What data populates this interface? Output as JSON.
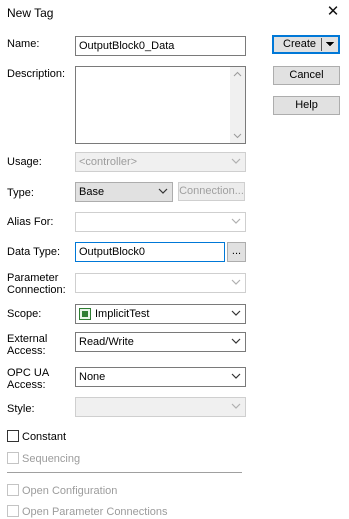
{
  "window": {
    "title": "New Tag",
    "close_glyph": "✕"
  },
  "buttons": {
    "create": "Create",
    "cancel": "Cancel",
    "help": "Help",
    "connection": "Connection...",
    "browse": "..."
  },
  "labels": {
    "name": "Name:",
    "description": "Description:",
    "usage": "Usage:",
    "type": "Type:",
    "alias_for": "Alias For:",
    "data_type": "Data Type:",
    "parameter_connection_1": "Parameter",
    "parameter_connection_2": "Connection:",
    "scope": "Scope:",
    "external_access_1": "External",
    "external_access_2": "Access:",
    "opc_ua_access_1": "OPC UA",
    "opc_ua_access_2": "Access:",
    "style": "Style:"
  },
  "fields": {
    "name": "OutputBlock0_Data",
    "description": "",
    "usage": "<controller>",
    "type": "Base",
    "alias_for": "",
    "data_type": "OutputBlock0",
    "parameter_connection": "",
    "scope": "ImplicitTest",
    "external_access": "Read/Write",
    "opc_ua_access": "None",
    "style": ""
  },
  "checkboxes": {
    "constant": "Constant",
    "sequencing": "Sequencing",
    "open_configuration": "Open Configuration",
    "open_parameter_connections": "Open Parameter Connections"
  },
  "icons": {
    "close": "close-icon",
    "dropdown": "chevron-down-icon",
    "scope": "controller-icon"
  }
}
